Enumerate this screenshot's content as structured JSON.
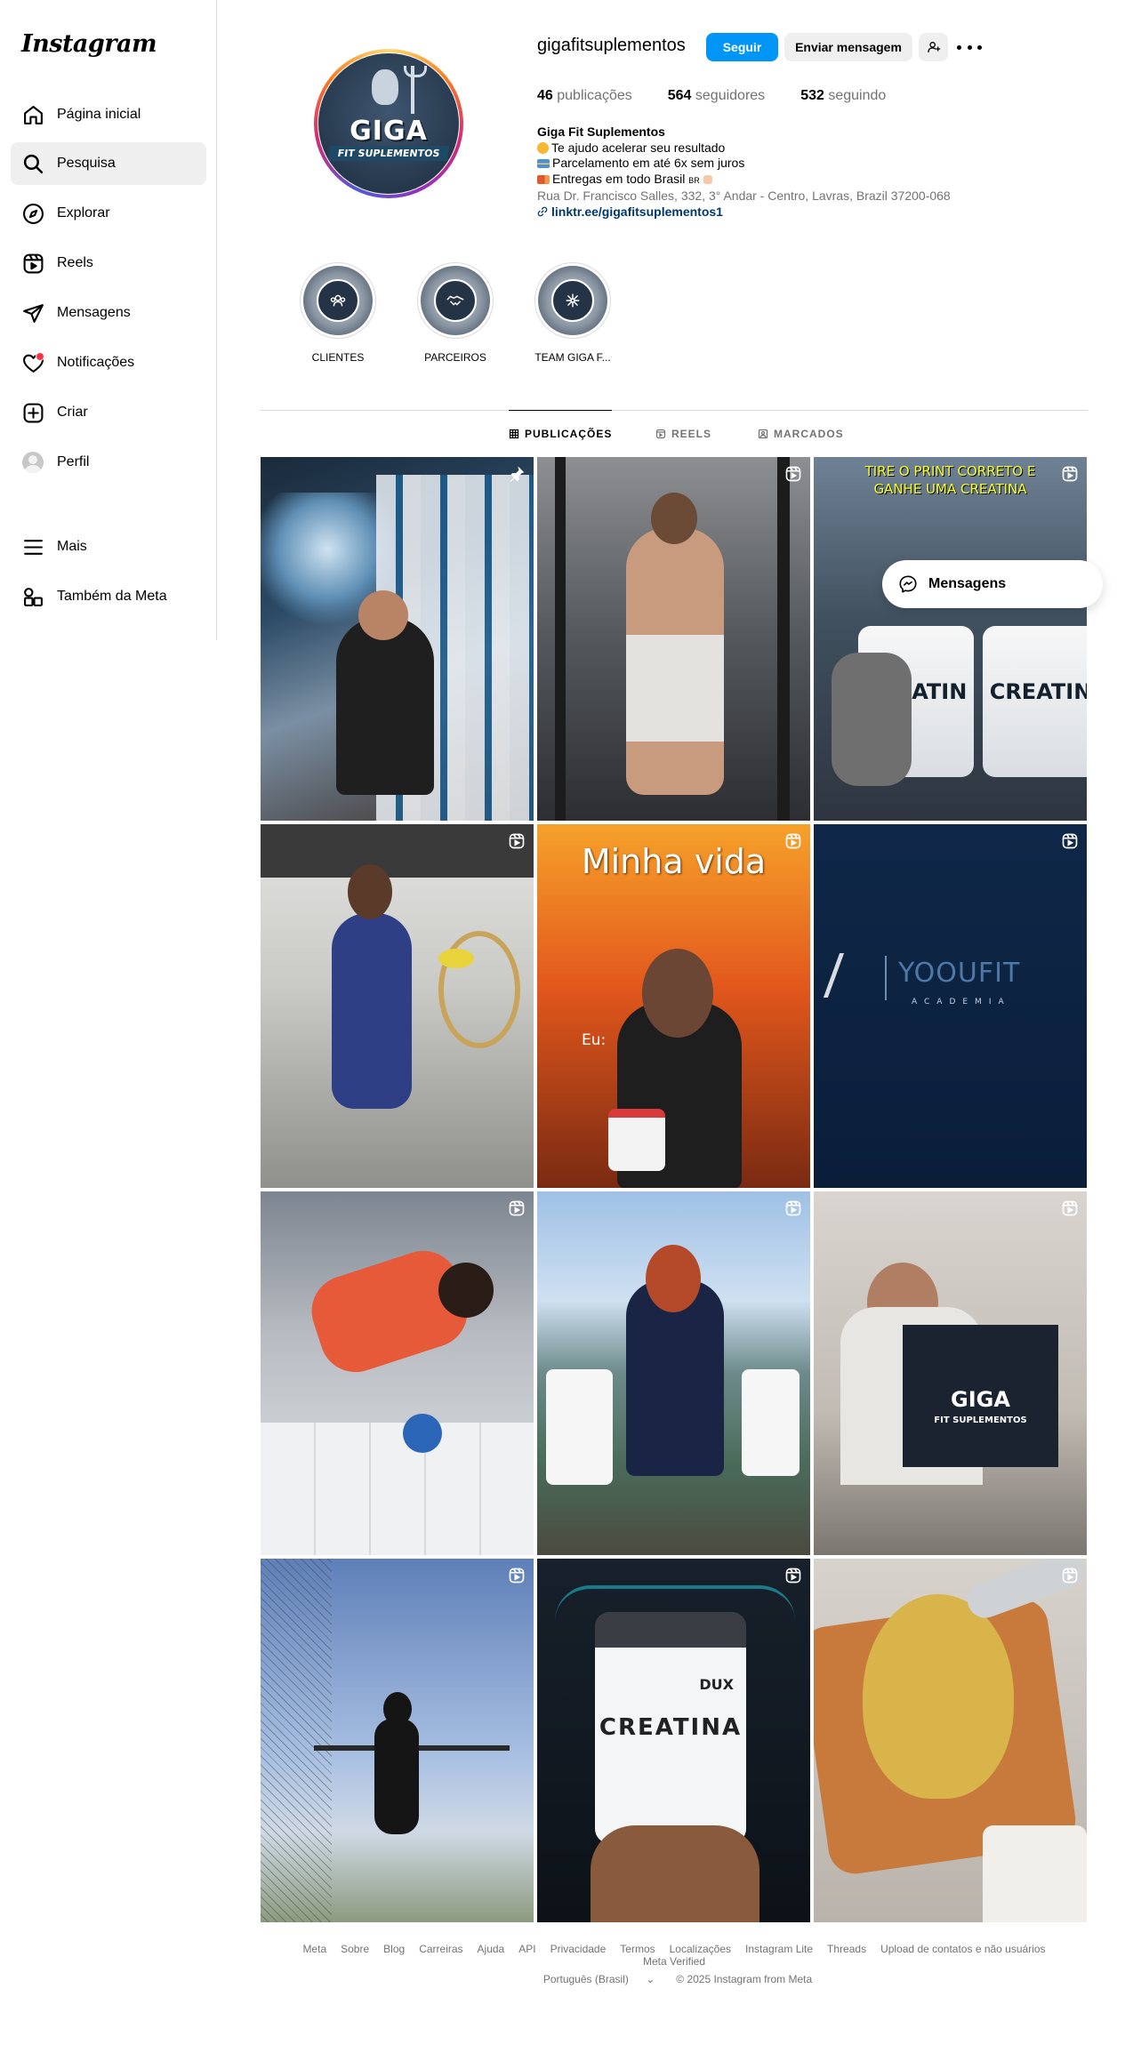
{
  "brand": {
    "logo_text": "Instagram"
  },
  "sidebar": {
    "items": [
      {
        "label": "Página inicial",
        "icon": "home-icon"
      },
      {
        "label": "Pesquisa",
        "icon": "search-icon",
        "active": true
      },
      {
        "label": "Explorar",
        "icon": "compass-icon"
      },
      {
        "label": "Reels",
        "icon": "reels-icon"
      },
      {
        "label": "Mensagens",
        "icon": "direct-icon"
      },
      {
        "label": "Notificações",
        "icon": "heart-icon",
        "badge_dot": true
      },
      {
        "label": "Criar",
        "icon": "plus-square-icon"
      },
      {
        "label": "Perfil",
        "icon": "avatar"
      },
      {
        "label": "Mais",
        "icon": "menu-icon"
      },
      {
        "label": "Também da Meta",
        "icon": "meta-apps-icon"
      }
    ]
  },
  "profile": {
    "username": "gigafitsuplementos",
    "follow_label": "Seguir",
    "message_label": "Enviar mensagem",
    "avatar_text_big": "GIGA",
    "avatar_text_small": "FIT SUPLEMENTOS",
    "stats": {
      "posts_count": "46",
      "posts_label": "publicações",
      "followers_count": "564",
      "followers_label": "seguidores",
      "following_count": "532",
      "following_label": "seguindo"
    },
    "bio": {
      "name": "Giga Fit Suplementos",
      "line1": "Te ajudo acelerar seu resultado",
      "line2": "Parcelamento em até 6x sem juros",
      "line3": "Entregas em todo Brasil",
      "line3_suffix": "BR",
      "address": "Rua Dr. Francisco Salles, 332, 3° Andar - Centro, Lavras, Brazil 37200-068",
      "link": "linktr.ee/gigafitsuplementos1"
    }
  },
  "highlights": [
    {
      "label": "CLIENTES"
    },
    {
      "label": "PARCEIROS"
    },
    {
      "label": "TEAM GIGA F..."
    }
  ],
  "tabs": [
    {
      "label": "PUBLICAÇÕES",
      "active": true
    },
    {
      "label": "REELS"
    },
    {
      "label": "MARCADOS"
    }
  ],
  "posts": [
    {
      "type": "pinned",
      "overlay": ""
    },
    {
      "type": "reel",
      "overlay": ""
    },
    {
      "type": "reel",
      "overlay": "TIRE O PRINT CORRETO E GANHE UMA CREATINA",
      "product_text": "CREATIN"
    },
    {
      "type": "reel",
      "overlay": ""
    },
    {
      "type": "reel",
      "overlay": "Minha vida",
      "overlay2": "Eu:"
    },
    {
      "type": "reel",
      "overlay": "YOOUFIT",
      "overlay2": "ACADEMIA"
    },
    {
      "type": "reel",
      "overlay": ""
    },
    {
      "type": "reel",
      "overlay": ""
    },
    {
      "type": "reel",
      "overlay": "GIGA",
      "overlay2": "FIT SUPLEMENTOS"
    },
    {
      "type": "reel",
      "overlay": ""
    },
    {
      "type": "reel",
      "overlay": "CREATINA",
      "overlay2": "DUX"
    },
    {
      "type": "reel",
      "overlay": ""
    }
  ],
  "floating_messages": {
    "label": "Mensagens"
  },
  "footer": {
    "links": [
      "Meta",
      "Sobre",
      "Blog",
      "Carreiras",
      "Ajuda",
      "API",
      "Privacidade",
      "Termos",
      "Localizações",
      "Instagram Lite",
      "Threads",
      "Upload de contatos e não usuários",
      "Meta Verified"
    ],
    "language": "Português (Brasil)",
    "copyright": "© 2025 Instagram from Meta"
  },
  "colors": {
    "primary_button": "#0095f6",
    "secondary_button": "#efefef",
    "muted_text": "#737373",
    "link_text": "#00376b",
    "notification_dot": "#ff3040"
  }
}
